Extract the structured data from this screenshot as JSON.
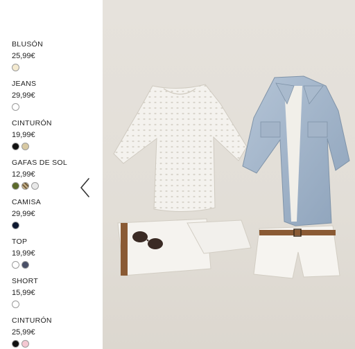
{
  "products": [
    {
      "name": "BLUSÓN",
      "price": "25,99€",
      "swatches": [
        {
          "color": "#f4ead0"
        }
      ]
    },
    {
      "name": "JEANS",
      "price": "29,99€",
      "swatches": [
        {
          "color": "#ffffff"
        }
      ]
    },
    {
      "name": "CINTURÓN",
      "price": "19,99€",
      "swatches": [
        {
          "color": "#111111"
        },
        {
          "color": "#d8c9a2"
        }
      ]
    },
    {
      "name": "GAFAS DE SOL",
      "price": "12,99€",
      "swatches": [
        {
          "color": "#5b6a2a"
        },
        {
          "color": "#9a8460",
          "texture": true
        },
        {
          "color": "#e8e8e8"
        }
      ]
    },
    {
      "name": "CAMISA",
      "price": "29,99€",
      "swatches": [
        {
          "color": "#0c1830"
        }
      ]
    },
    {
      "name": "TOP",
      "price": "19,99€",
      "swatches": [
        {
          "color": "#ffffff"
        },
        {
          "color": "#4a5068"
        }
      ]
    },
    {
      "name": "SHORT",
      "price": "15,99€",
      "swatches": [
        {
          "color": "#ffffff"
        }
      ]
    },
    {
      "name": "CINTURÓN",
      "price": "25,99€",
      "swatches": [
        {
          "color": "#111111"
        },
        {
          "color": "#f4c8d2"
        }
      ]
    }
  ],
  "nav": {
    "prev_icon": "chevron-left-icon"
  },
  "photo": {
    "background_color": "#e4e0da"
  }
}
